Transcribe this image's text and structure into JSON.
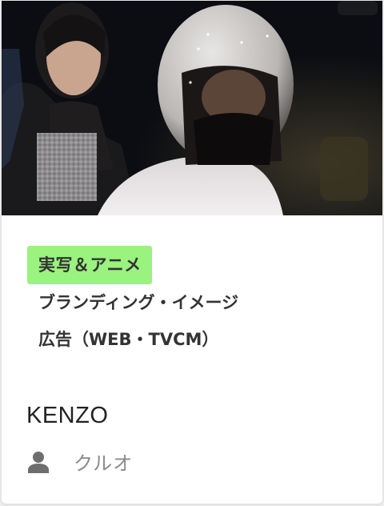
{
  "card": {
    "thumbnail_alt": "KENZO",
    "tags": {
      "primary": "実写＆アニメ",
      "line1": "ブランディング・イメージ",
      "line2": "広告（WEB・TVCM）"
    },
    "title": "KENZO",
    "author": {
      "icon": "user-icon",
      "name": "クルオ"
    }
  },
  "colors": {
    "tag_highlight": "#9af27f",
    "text_dark": "#333333",
    "text_muted": "#8a8a8a",
    "icon": "#6e6e6e"
  }
}
